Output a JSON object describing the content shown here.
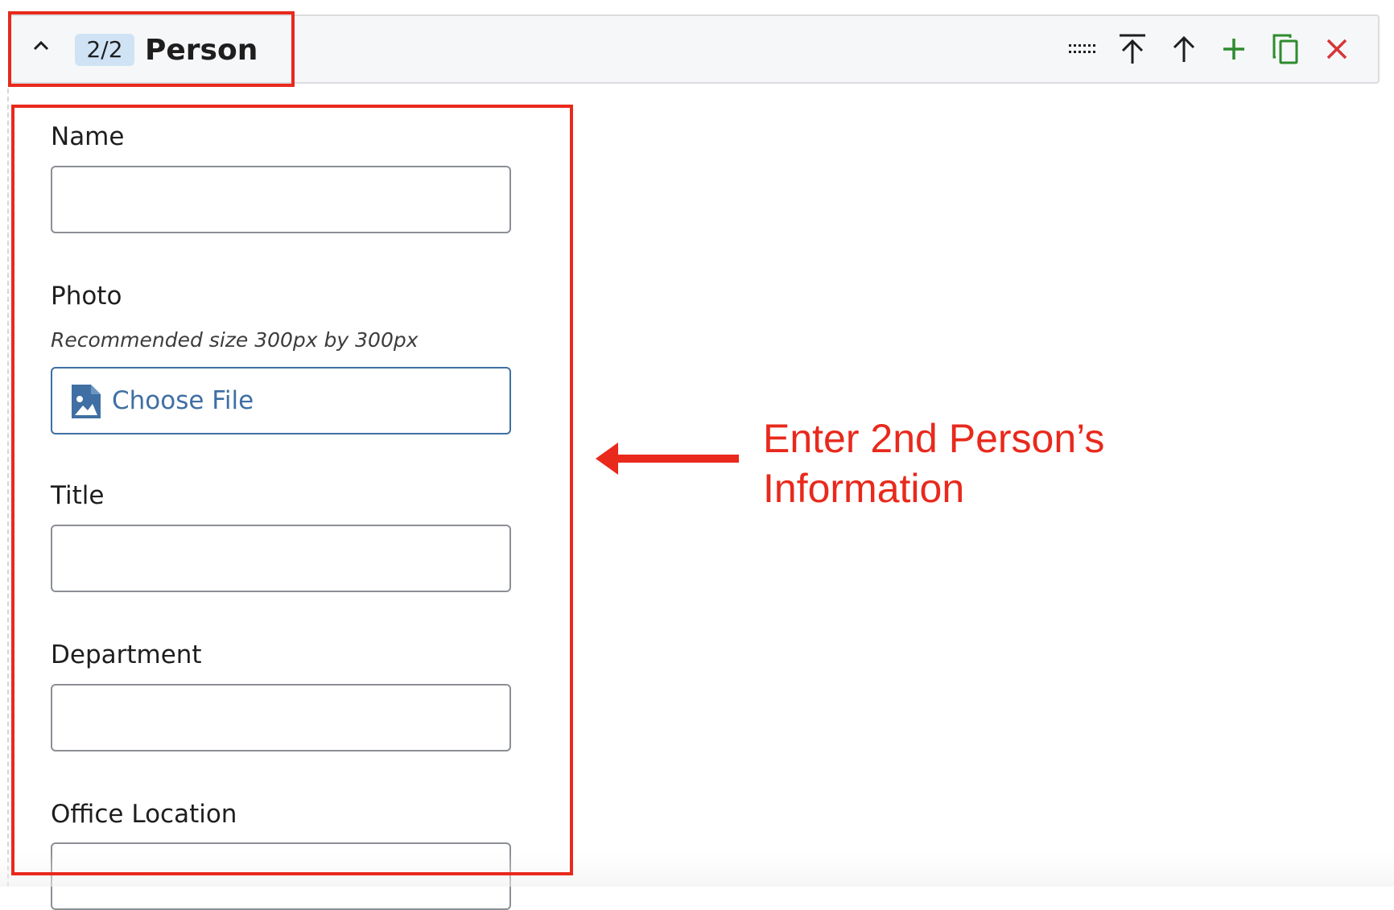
{
  "block": {
    "counter": "2/2",
    "title": "Person"
  },
  "toolbar": {
    "icons": [
      "drag-handle-icon",
      "move-to-top-icon",
      "move-up-icon",
      "add-icon",
      "duplicate-icon",
      "remove-icon"
    ],
    "colors": {
      "default": "#1e1e1e",
      "add": "#2e8b2e",
      "duplicate": "#2e8b2e",
      "remove": "#d63638"
    }
  },
  "fields": {
    "name": {
      "label": "Name",
      "value": ""
    },
    "photo": {
      "label": "Photo",
      "help": "Recommended size 300px by 300px",
      "button_label": "Choose File"
    },
    "title": {
      "label": "Title",
      "value": ""
    },
    "department": {
      "label": "Department",
      "value": ""
    },
    "office_location": {
      "label": "Office Location",
      "value": ""
    }
  },
  "annotation": {
    "text_line1": "Enter 2nd Person’s",
    "text_line2": "Information",
    "color": "#e8291c"
  }
}
